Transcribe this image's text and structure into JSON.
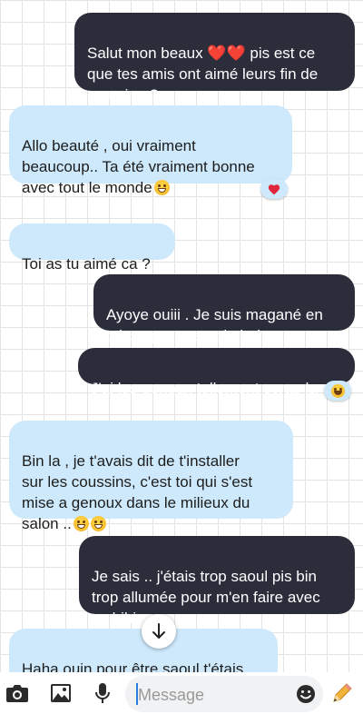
{
  "messages": [
    {
      "side": "out",
      "text": "Salut mon beaux ❤️❤️ pis est ce\nque tes amis ont aimé leurs fin de\nsemaine ?"
    },
    {
      "side": "in",
      "text": "Allo beauté , oui vraiment\nbeaucoup.. Ta été vraiment bonne\navec tout le monde"
    },
    {
      "side": "in",
      "text": "Toi as tu aimé ca ?"
    },
    {
      "side": "out",
      "text": "Ayoye ouiii . Je suis magané en\ncrisse par exemple haha"
    },
    {
      "side": "out",
      "text": "J'ai les genoux tellement scrap la"
    },
    {
      "side": "in",
      "text": "Bin la , je t'avais dit de t'installer\nsur les coussins,  c'est toi qui s'est\nmise a genoux dans le milieux du\nsalon .."
    },
    {
      "side": "out",
      "text": "Je sais .. j'étais trop saoul pis bin\ntrop allumée pour m'en faire avec\nca hihi"
    },
    {
      "side": "in",
      "text": "Haha ouin pour être saoul t'étais\nsaoul en esti"
    }
  ],
  "reactions": [
    {
      "emoji": "heart",
      "color": "#e0263a"
    },
    {
      "emoji": "laughing-face"
    }
  ],
  "composer": {
    "placeholder": "Message",
    "value": ""
  },
  "colors": {
    "outgoing_bubble": "#2b2d3b",
    "incoming_bubble": "#cde9fb",
    "accent_pencil": "#f2b33d"
  }
}
